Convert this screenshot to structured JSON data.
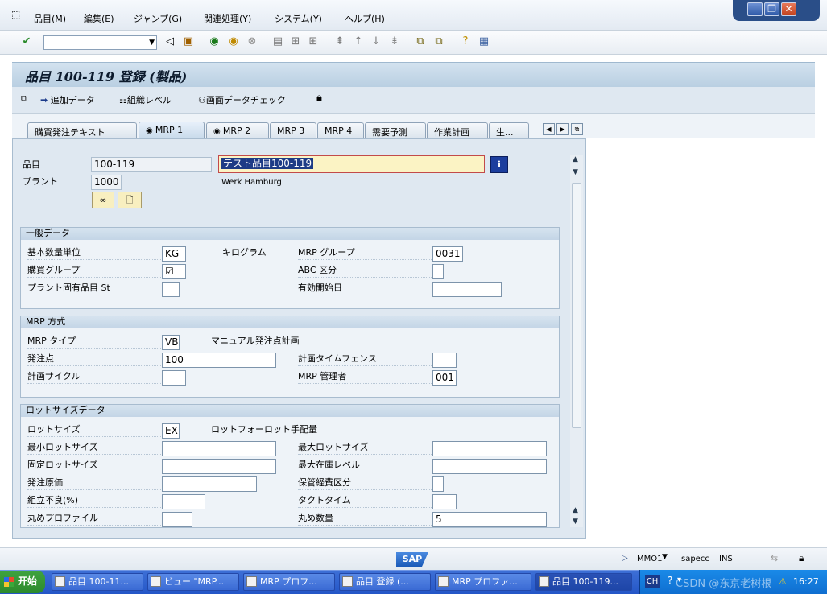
{
  "menu": {
    "items": [
      "品目(M)",
      "編集(E)",
      "ジャンプ(G)",
      "関連処理(Y)",
      "システム(Y)",
      "ヘルプ(H)"
    ]
  },
  "window_controls": {
    "minimize": "_",
    "restore": "❐",
    "close": "✕"
  },
  "toolbar": {
    "command_value": ""
  },
  "title": "品目 100-119 登録 (製品)",
  "app_toolbar": {
    "add_data": "追加データ",
    "org_level": "組織レベル",
    "check": "画面データチェック"
  },
  "tabs": [
    "購買発注テキスト",
    "MRP 1",
    "MRP 2",
    "MRP 3",
    "MRP 4",
    "需要予測",
    "作業計画",
    "生..."
  ],
  "header": {
    "material_label": "品目",
    "material_value": "100-119",
    "material_desc": "テスト品目100-119",
    "plant_label": "プラント",
    "plant_value": "1000",
    "plant_desc": "Werk Hamburg"
  },
  "general": {
    "title": "一般データ",
    "base_uom_label": "基本数量単位",
    "base_uom_value": "KG",
    "base_uom_text": "キログラム",
    "mrp_group_label": "MRP グループ",
    "mrp_group_value": "0031",
    "purch_group_label": "購買グループ",
    "purch_group_value": "☑",
    "abc_label": "ABC 区分",
    "abc_value": "",
    "plant_status_label": "プラント固有品目 St",
    "plant_status_value": "",
    "valid_from_label": "有効開始日",
    "valid_from_value": ""
  },
  "mrp_proc": {
    "title": "MRP 方式",
    "mrp_type_label": "MRP タイプ",
    "mrp_type_value": "VB",
    "mrp_type_text": "マニュアル発注点計画",
    "reorder_label": "発注点",
    "reorder_value": "100",
    "fence_label": "計画タイムフェンス",
    "fence_value": "",
    "cycle_label": "計画サイクル",
    "cycle_value": "",
    "controller_label": "MRP 管理者",
    "controller_value": "001"
  },
  "lot": {
    "title": "ロットサイズデータ",
    "lot_size_label": "ロットサイズ",
    "lot_size_value": "EX",
    "lot_size_text": "ロットフォーロット手配量",
    "min_label": "最小ロットサイズ",
    "min_value": "",
    "max_label": "最大ロットサイズ",
    "max_value": "",
    "fixed_label": "固定ロットサイズ",
    "fixed_value": "",
    "max_stock_label": "最大在庫レベル",
    "max_stock_value": "",
    "ordering_cost_label": "発注原価",
    "ordering_cost_value": "",
    "storage_cost_label": "保管経費区分",
    "storage_cost_value": "",
    "assembly_scrap_label": "組立不良(%)",
    "assembly_scrap_value": "",
    "takt_label": "タクトタイム",
    "takt_value": "",
    "rounding_profile_label": "丸めプロファイル",
    "rounding_profile_value": "",
    "rounding_qty_label": "丸め数量",
    "rounding_qty_value": "5"
  },
  "status": {
    "system": "MMO1",
    "server": "sapecc",
    "mode": "INS"
  },
  "taskbar": {
    "start": "开始",
    "tasks": [
      "品目 100-11...",
      "ビュー \"MRP...",
      "MRP プロフ...",
      "品目 登録 (...",
      "MRP プロファ...",
      "品目 100-119..."
    ],
    "lang": "CH",
    "clock": "16:27",
    "watermark": "CSDN @东京老树根"
  }
}
